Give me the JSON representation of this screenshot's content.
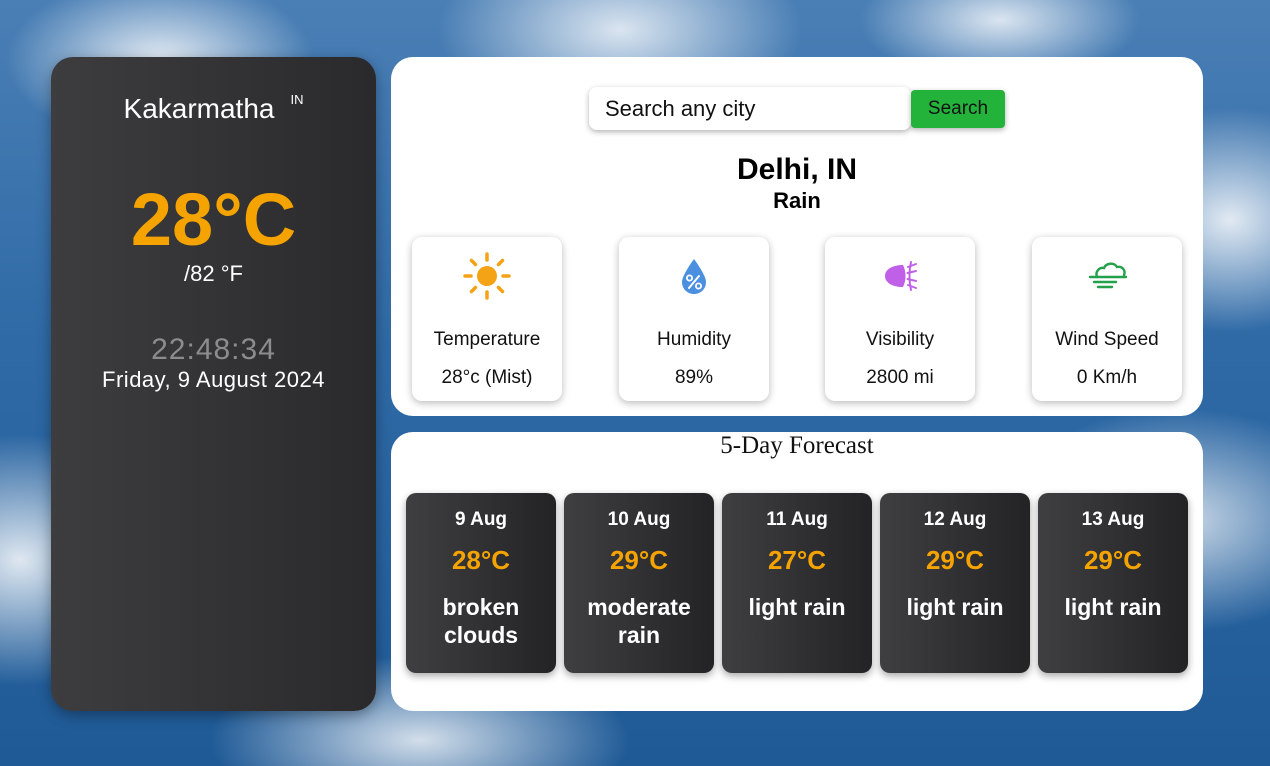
{
  "current": {
    "city": "Kakarmatha",
    "country": "IN",
    "temp_c": "28°C",
    "temp_f": "/82 °F",
    "time": "22:48:34",
    "date": "Friday, 9 August 2024"
  },
  "search": {
    "placeholder": "Search any city",
    "button_label": "Search"
  },
  "location": {
    "title": "Delhi, IN",
    "condition": "Rain"
  },
  "metrics": [
    {
      "icon": "sun-icon",
      "label": "Temperature",
      "value": "28°c (Mist)"
    },
    {
      "icon": "humidity-icon",
      "label": "Humidity",
      "value": "89%"
    },
    {
      "icon": "visibility-icon",
      "label": "Visibility",
      "value": "2800 mi"
    },
    {
      "icon": "wind-icon",
      "label": "Wind Speed",
      "value": "0 Km/h"
    }
  ],
  "forecast": {
    "title": "5-Day Forecast",
    "days": [
      {
        "date": "9 Aug",
        "temp": "28°C",
        "desc": "broken clouds"
      },
      {
        "date": "10 Aug",
        "temp": "29°C",
        "desc": "moderate rain"
      },
      {
        "date": "11 Aug",
        "temp": "27°C",
        "desc": "light rain"
      },
      {
        "date": "12 Aug",
        "temp": "29°C",
        "desc": "light rain"
      },
      {
        "date": "13 Aug",
        "temp": "29°C",
        "desc": "light rain"
      }
    ]
  },
  "colors": {
    "accent_orange": "#f5a300",
    "search_green": "#23b33b",
    "sun_orange": "#f5a316",
    "humidity_blue": "#4a8fe0",
    "visibility_purple": "#c060e8",
    "wind_green": "#22a04a"
  }
}
